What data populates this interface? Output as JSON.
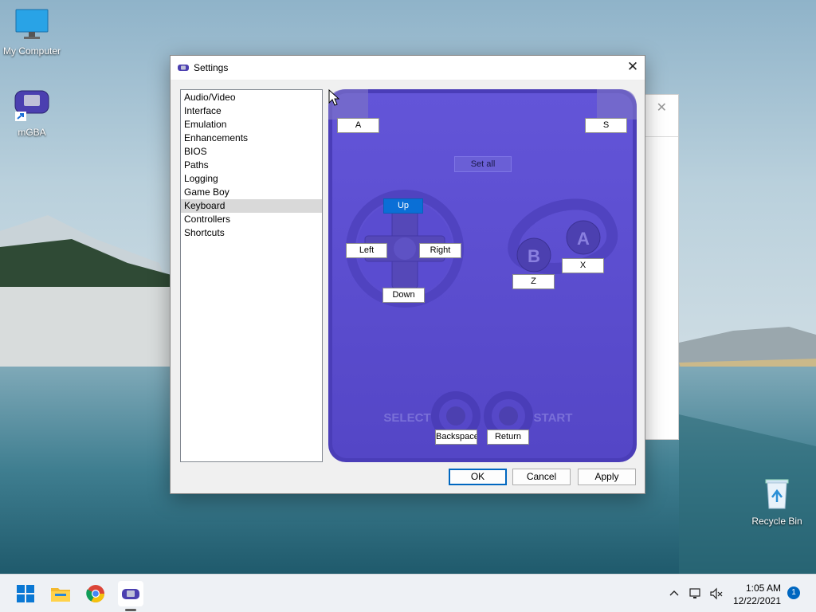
{
  "desktop": {
    "icons": [
      {
        "label": "My Computer",
        "icon": "monitor-icon"
      },
      {
        "label": "mGBA",
        "icon": "gameboy-advance-icon"
      },
      {
        "label": "Recycle Bin",
        "icon": "recycle-bin-icon"
      }
    ]
  },
  "dialog": {
    "title": "Settings",
    "close": "✕",
    "nav": [
      {
        "label": "Audio/Video"
      },
      {
        "label": "Interface"
      },
      {
        "label": "Emulation"
      },
      {
        "label": "Enhancements"
      },
      {
        "label": "BIOS"
      },
      {
        "label": "Paths"
      },
      {
        "label": "Logging"
      },
      {
        "label": "Game Boy"
      },
      {
        "label": "Keyboard",
        "selected": true
      },
      {
        "label": "Controllers"
      },
      {
        "label": "Shortcuts"
      }
    ],
    "controller": {
      "set_all": "Set all",
      "keys": {
        "l_shoulder": "A",
        "r_shoulder": "S",
        "up": "Up",
        "left": "Left",
        "right": "Right",
        "down": "Down",
        "b_button": "Z",
        "a_button": "X",
        "select": "Backspace",
        "start": "Return"
      },
      "face_labels": {
        "a": "A",
        "b": "B"
      },
      "select_label": "SELECT",
      "start_label": "START",
      "body_color": "#5a4ccf"
    },
    "buttons": {
      "ok": "OK",
      "cancel": "Cancel",
      "apply": "Apply"
    }
  },
  "taskbar": {
    "apps": [
      "windows-start-icon",
      "file-explorer-icon",
      "chrome-icon",
      "mgba-icon"
    ],
    "time": "1:05 AM",
    "date": "12/22/2021",
    "notification_count": "1"
  }
}
